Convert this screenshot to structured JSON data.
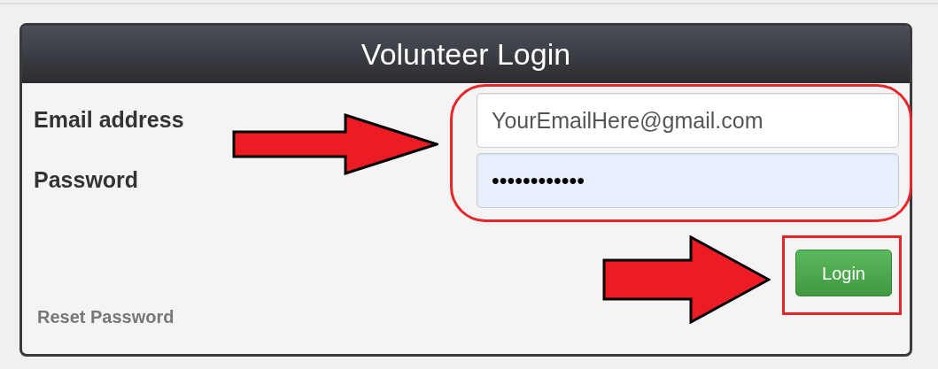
{
  "panel": {
    "title": "Volunteer Login"
  },
  "fields": [
    {
      "label": "Email address",
      "value": "YourEmailHere@gmail.com",
      "autofilled": false
    },
    {
      "label": "Password",
      "value": "••••••••••••",
      "autofilled": true
    }
  ],
  "login_button": "Login",
  "reset_link": "Reset Password"
}
